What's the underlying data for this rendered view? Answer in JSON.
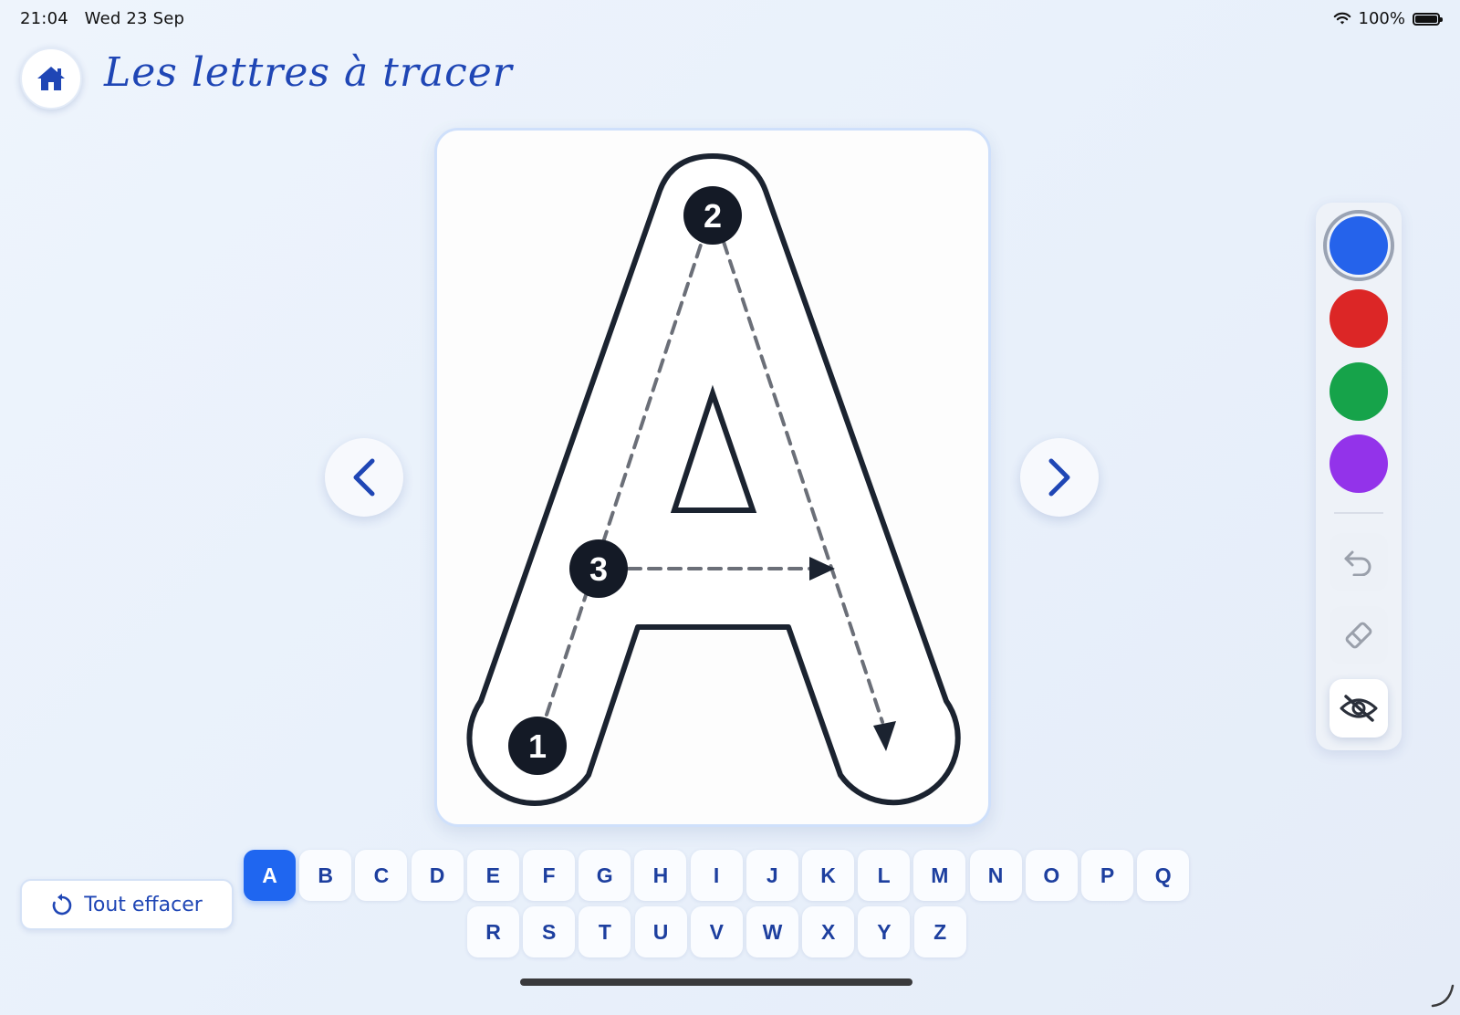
{
  "status_bar": {
    "time": "21:04",
    "date": "Wed 23 Sep",
    "battery": "100%"
  },
  "header": {
    "title": "Les lettres à tracer"
  },
  "card": {
    "letter": "A",
    "step_numbers": [
      "1",
      "2",
      "3"
    ]
  },
  "palette": {
    "colors": [
      {
        "name": "blue",
        "hex": "#2563eb",
        "selected": true
      },
      {
        "name": "red",
        "hex": "#dc2626",
        "selected": false
      },
      {
        "name": "green",
        "hex": "#16a34a",
        "selected": false
      },
      {
        "name": "purple",
        "hex": "#9333ea",
        "selected": false
      }
    ],
    "tools": [
      "undo-icon",
      "eraser-icon",
      "eye-off-icon"
    ]
  },
  "actions": {
    "clear_label": "Tout effacer"
  },
  "alphabet": {
    "row1": [
      "A",
      "B",
      "C",
      "D",
      "E",
      "F",
      "G",
      "H",
      "I",
      "J",
      "K",
      "L",
      "M",
      "N",
      "O",
      "P",
      "Q"
    ],
    "row2": [
      "R",
      "S",
      "T",
      "U",
      "V",
      "W",
      "X",
      "Y",
      "Z"
    ],
    "selected": "A"
  },
  "theme": {
    "accent": "#1f66f0",
    "title_color": "#1f46b5"
  }
}
